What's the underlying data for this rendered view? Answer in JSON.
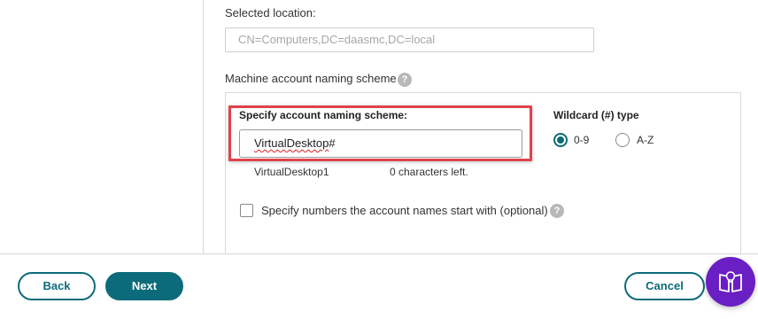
{
  "location": {
    "label": "Selected location:",
    "value": "CN=Computers,DC=daasmc,DC=local"
  },
  "naming": {
    "label": "Machine account naming scheme",
    "help_icon": "question-circle-icon",
    "specify_label": "Specify account naming scheme:",
    "scheme_value": "VirtualDesktop#",
    "scheme_value_underlined_part": "VirtualDesktop",
    "scheme_value_suffix": "#",
    "preview_name": "VirtualDesktop1",
    "chars_left": "0 characters left."
  },
  "wildcard": {
    "title": "Wildcard (#) type",
    "options": [
      {
        "label": "0-9",
        "selected": true
      },
      {
        "label": "A-Z",
        "selected": false
      }
    ]
  },
  "start_numbers": {
    "label": "Specify numbers the account names start with (optional)",
    "checked": false,
    "help_icon": "question-circle-icon"
  },
  "footer": {
    "back_label": "Back",
    "next_label": "Next",
    "cancel_label": "Cancel",
    "assist_icon": "book-lightbulb-icon"
  },
  "colors": {
    "accent": "#0c6b7a",
    "highlight": "#e0434b",
    "assist": "#6a1fc4"
  }
}
